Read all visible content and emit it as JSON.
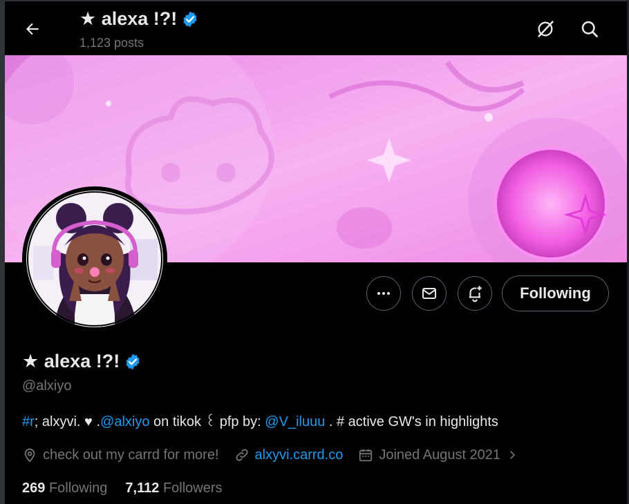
{
  "header": {
    "display_name": "★ alexa !?!",
    "posts_count": "1,123 posts"
  },
  "profile": {
    "display_name": "★ alexa !?!",
    "handle": "@alxiyo",
    "bio": {
      "hashtag": "#r",
      "part1": "; alxyvi.  ♥  .",
      "mention1": "@alxiyo",
      "part2": " on tikok ꒰ pfp by: ",
      "mention2": "@V_iluuu",
      "part3": " . # active GW's in highlights"
    },
    "location": "check out my carrd for more!",
    "website": "alxyvi.carrd.co",
    "joined": "Joined August 2021",
    "following_count": "269",
    "following_label": "Following",
    "followers_count": "7,112",
    "followers_label": "Followers"
  },
  "actions": {
    "follow_label": "Following"
  },
  "icons": {
    "back": "arrow-left-icon",
    "grok": "grok-icon",
    "search": "search-icon",
    "more": "more-dots-icon",
    "message": "envelope-icon",
    "notify": "bell-plus-icon",
    "verified": "verified-badge-icon",
    "location": "location-pin-icon",
    "link": "link-icon",
    "calendar": "calendar-icon"
  },
  "colors": {
    "background": "#000000",
    "accent": "#1d9bf0",
    "text": "#e7e9ea",
    "muted": "#71767b",
    "banner_pink": "#f5a6f0"
  }
}
